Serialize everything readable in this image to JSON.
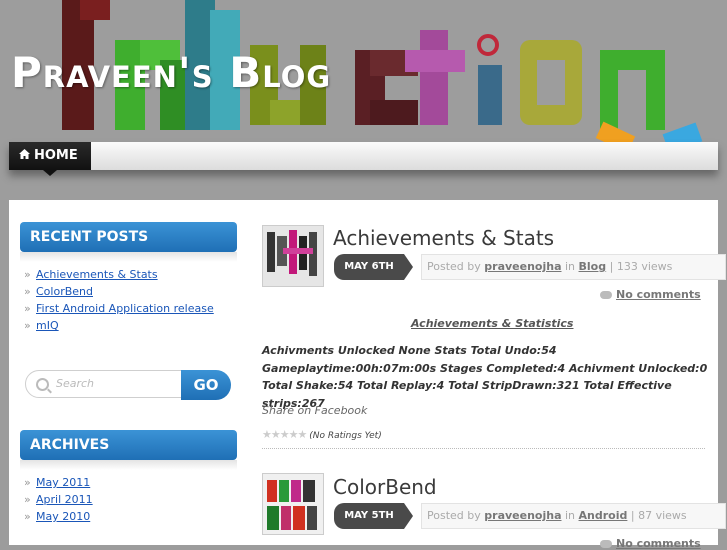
{
  "header": {
    "blog_title": "Praveen's Blog",
    "home_tab": "HOME"
  },
  "sidebar": {
    "recent_posts_title": "RECENT POSTS",
    "recent_posts": [
      "Achievements & Stats",
      "ColorBend",
      "First Android Application release",
      "mIQ"
    ],
    "search_placeholder": "Search",
    "go_label": "GO",
    "archives_title": "ARCHIVES",
    "archives": [
      "May 2011",
      "April 2011",
      "May 2010"
    ]
  },
  "posts": [
    {
      "title": "Achievements & Stats",
      "date": "MAY 6TH",
      "posted_by": "Posted by",
      "author": "praveenojha",
      "in": "in",
      "category": "Blog",
      "views": "| 133 views",
      "comments": "No comments",
      "subtitle": "Achievements & Statistics",
      "body": "Achivments Unlocked None Stats Total Undo:54 Gameplaytime:00h:07m:00s Stages Completed:4 Achivment Unlocked:0 Total Shake:54 Total Replay:4 Total StripDrawn:321 Total Effective strips:267",
      "share": "Share on Facebook",
      "rating": "(No Ratings Yet)"
    },
    {
      "title": "ColorBend",
      "date": "MAY 5TH",
      "posted_by": "Posted by",
      "author": "praveenojha",
      "in": "in",
      "category": "Android",
      "views": "| 87 views",
      "comments": "No comments"
    }
  ],
  "colors": {
    "accent_blue": "#1f6fb5",
    "header_gray": "#9d9d9d",
    "link_blue": "#1a56b8"
  }
}
